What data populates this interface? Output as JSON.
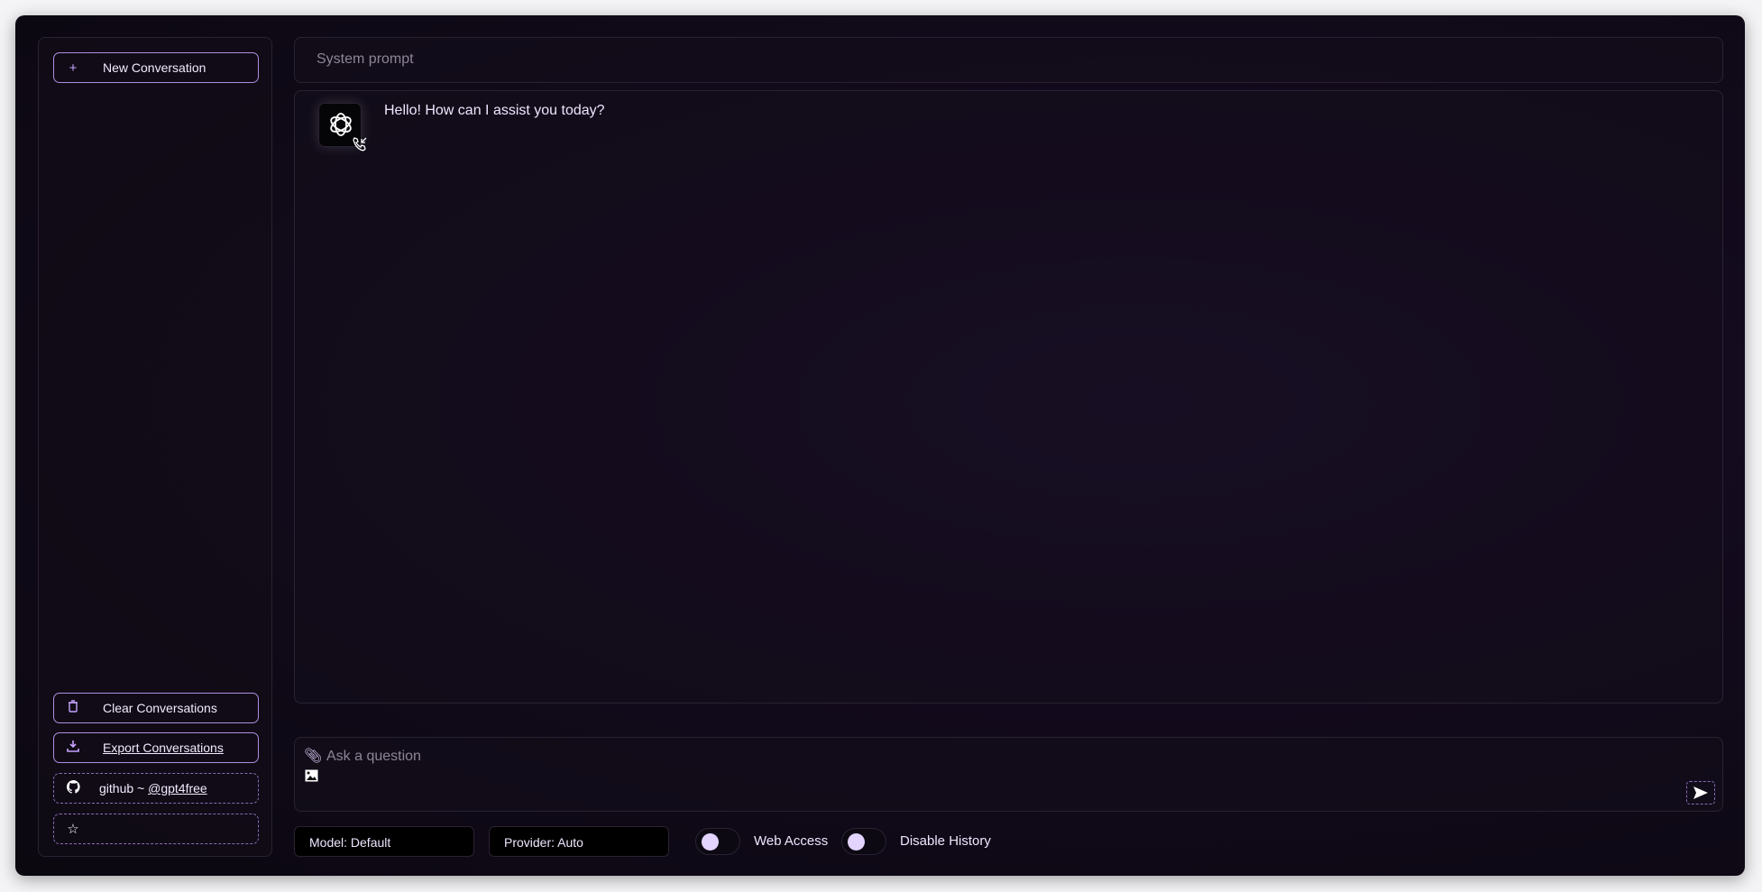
{
  "sidebar": {
    "new_conversation": "New Conversation",
    "clear_conversations": "Clear Conversations",
    "export_conversations": "Export Conversations",
    "github_prefix": "github ~ ",
    "github_handle": "@gpt4free"
  },
  "main": {
    "system_prompt_placeholder": "System prompt",
    "messages": [
      {
        "role": "assistant",
        "text": "Hello! How can I assist you today?"
      }
    ],
    "input_placeholder": "Ask a question"
  },
  "footer": {
    "model": "Model: Default",
    "provider": "Provider: Auto",
    "web_access_label": "Web Access",
    "web_access": false,
    "disable_history_label": "Disable History",
    "disable_history": false
  },
  "colors": {
    "accent": "#b08ee0",
    "background": "#120a1c"
  }
}
